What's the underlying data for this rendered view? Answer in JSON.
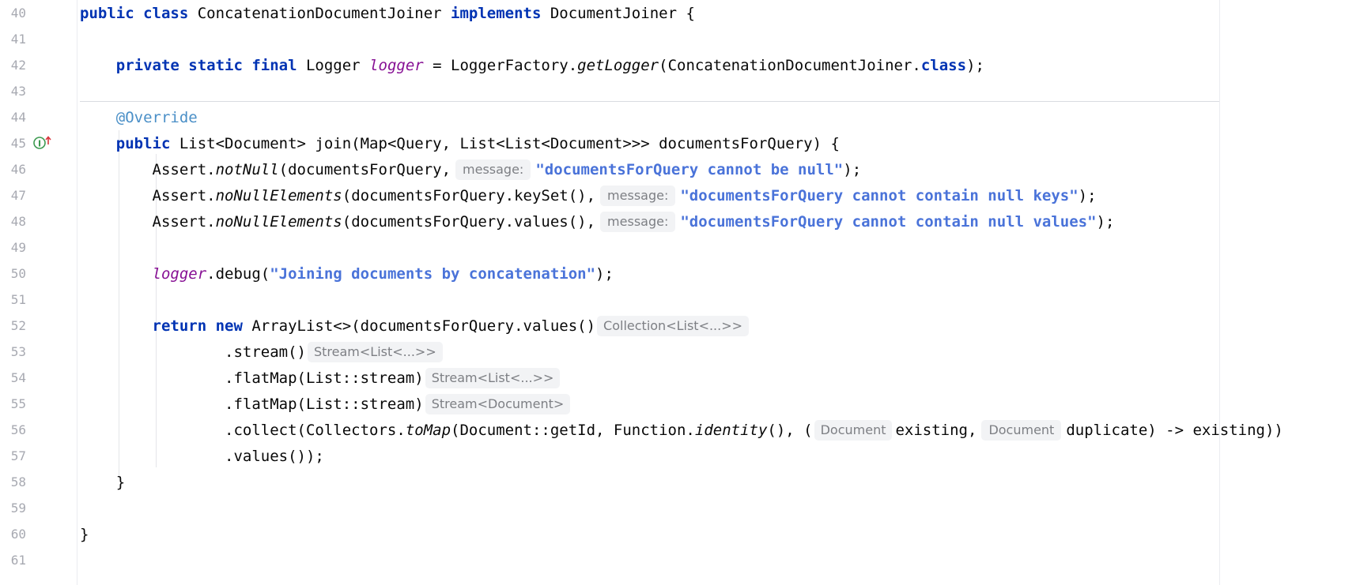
{
  "editor": {
    "colors": {
      "keyword": "#0033b3",
      "string": "#4a73d9",
      "annotation": "#4a8fc7",
      "line_number": "#a7a9b1",
      "hint_text": "#7d7f84",
      "hint_bg": "#f2f3f5"
    },
    "gutter": {
      "implements_icon": "implements-method-icon"
    },
    "lines": [
      {
        "n": "40",
        "tokens": [
          {
            "t": "public class ",
            "c": "kw"
          },
          {
            "t": "ConcatenationDocumentJoiner "
          },
          {
            "t": "implements ",
            "c": "kw"
          },
          {
            "t": "DocumentJoiner {"
          }
        ]
      },
      {
        "n": "41",
        "tokens": []
      },
      {
        "n": "42",
        "tokens": [
          {
            "t": "    "
          },
          {
            "t": "private static final ",
            "c": "kw"
          },
          {
            "t": "Logger "
          },
          {
            "t": "logger",
            "c": "fld"
          },
          {
            "t": " = LoggerFactory."
          },
          {
            "t": "getLogger",
            "c": "it"
          },
          {
            "t": "(ConcatenationDocumentJoiner."
          },
          {
            "t": "class",
            "c": "kw"
          },
          {
            "t": ");"
          }
        ]
      },
      {
        "n": "43",
        "tokens": []
      },
      {
        "n": "44",
        "tokens": [
          {
            "t": "    "
          },
          {
            "t": "@Override",
            "c": "ann"
          }
        ]
      },
      {
        "n": "45",
        "tokens": [
          {
            "t": "    "
          },
          {
            "t": "public ",
            "c": "kw"
          },
          {
            "t": "List<Document> join(Map<Query, List<List<Document>>> documentsForQuery) {"
          }
        ]
      },
      {
        "n": "46",
        "tokens": [
          {
            "t": "        Assert."
          },
          {
            "t": "notNull",
            "c": "it"
          },
          {
            "t": "(documentsForQuery,"
          },
          {
            "t": "message:",
            "c": "hint-param"
          },
          {
            "t": "\"documentsForQuery cannot be null\"",
            "c": "str"
          },
          {
            "t": ");"
          }
        ]
      },
      {
        "n": "47",
        "tokens": [
          {
            "t": "        Assert."
          },
          {
            "t": "noNullElements",
            "c": "it"
          },
          {
            "t": "(documentsForQuery.keySet(),"
          },
          {
            "t": "message:",
            "c": "hint-param"
          },
          {
            "t": "\"documentsForQuery cannot contain null keys\"",
            "c": "str"
          },
          {
            "t": ");"
          }
        ]
      },
      {
        "n": "48",
        "tokens": [
          {
            "t": "        Assert."
          },
          {
            "t": "noNullElements",
            "c": "it"
          },
          {
            "t": "(documentsForQuery.values(),"
          },
          {
            "t": "message:",
            "c": "hint-param"
          },
          {
            "t": "\"documentsForQuery cannot contain null values\"",
            "c": "str"
          },
          {
            "t": ");"
          }
        ]
      },
      {
        "n": "49",
        "tokens": []
      },
      {
        "n": "50",
        "tokens": [
          {
            "t": "        "
          },
          {
            "t": "logger",
            "c": "fld"
          },
          {
            "t": ".debug("
          },
          {
            "t": "\"Joining documents by concatenation\"",
            "c": "str"
          },
          {
            "t": ");"
          }
        ]
      },
      {
        "n": "51",
        "tokens": []
      },
      {
        "n": "52",
        "tokens": [
          {
            "t": "        "
          },
          {
            "t": "return new ",
            "c": "kw"
          },
          {
            "t": "ArrayList<>(documentsForQuery.values()"
          },
          {
            "t": "Collection<List<...>>",
            "c": "hint-type"
          }
        ]
      },
      {
        "n": "53",
        "tokens": [
          {
            "t": "                .stream()"
          },
          {
            "t": "Stream<List<...>>",
            "c": "hint-type"
          }
        ]
      },
      {
        "n": "54",
        "tokens": [
          {
            "t": "                .flatMap(List::stream)"
          },
          {
            "t": "Stream<List<...>>",
            "c": "hint-type"
          }
        ]
      },
      {
        "n": "55",
        "tokens": [
          {
            "t": "                .flatMap(List::stream)"
          },
          {
            "t": "Stream<Document>",
            "c": "hint-type"
          }
        ]
      },
      {
        "n": "56",
        "tokens": [
          {
            "t": "                .collect(Collectors."
          },
          {
            "t": "toMap",
            "c": "it"
          },
          {
            "t": "(Document::getId, Function."
          },
          {
            "t": "identity",
            "c": "it"
          },
          {
            "t": "(), ("
          },
          {
            "t": "Document",
            "c": "hint-type"
          },
          {
            "t": "existing,"
          },
          {
            "t": "Document",
            "c": "hint-param"
          },
          {
            "t": "duplicate) -> existing))"
          }
        ]
      },
      {
        "n": "57",
        "tokens": [
          {
            "t": "                .values());"
          }
        ]
      },
      {
        "n": "58",
        "tokens": [
          {
            "t": "    }"
          }
        ]
      },
      {
        "n": "59",
        "tokens": []
      },
      {
        "n": "60",
        "tokens": [
          {
            "t": "}"
          }
        ]
      },
      {
        "n": "61",
        "tokens": []
      }
    ]
  }
}
